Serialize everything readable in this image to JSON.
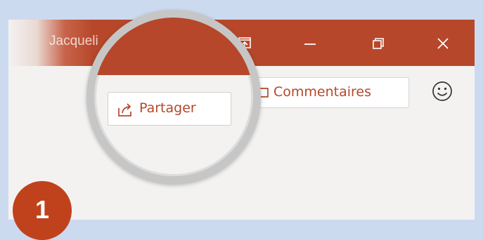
{
  "titlebar": {
    "user_name": "Jacqueli",
    "ribbon_display_icon": "ribbon-display-options-icon",
    "minimize_icon": "minimize-icon",
    "restore_icon": "restore-icon",
    "close_icon": "close-icon"
  },
  "ribbon": {
    "share_label": "Partager",
    "share_icon": "share-icon",
    "comments_label": "Commentaires",
    "comments_icon": "comment-icon",
    "feedback_icon": "smiley-icon"
  },
  "step": {
    "number": "1"
  },
  "colors": {
    "accent": "#b7472a",
    "badge": "#c0421d",
    "background": "#ccdaf0",
    "window": "#f3f2f1"
  }
}
